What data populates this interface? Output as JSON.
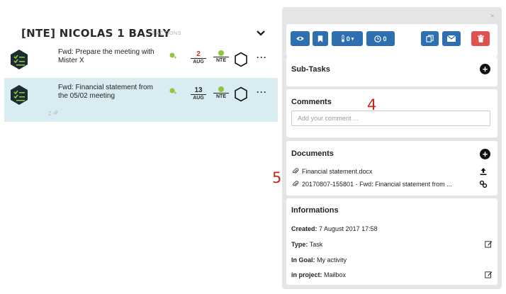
{
  "group": {
    "title": "[NTE] NICOLAS 1 BASILY",
    "count": "2 ACTIONS"
  },
  "tasks": [
    {
      "title": "Fwd: Prepare the meeting with Mister X",
      "day": "2",
      "month": "AUG",
      "assignee": "NTE"
    },
    {
      "title": "Fwd: Financial statement from the 05/02 meeting",
      "day": "13",
      "month": "AUG",
      "assignee": "NTE",
      "meta": "2"
    }
  ],
  "panel": {
    "close": "×",
    "toolbar": {
      "checklist_count": "0",
      "timer_count": "0"
    },
    "subtasks": {
      "title": "Sub-Tasks"
    },
    "comments": {
      "title": "Comments",
      "placeholder": "Add your comment ..."
    },
    "documents": {
      "title": "Documents",
      "items": [
        {
          "name": "Financial statement.docx"
        },
        {
          "name": "20170807-155801 - Fwd: Financial statement from ..."
        }
      ]
    },
    "informations": {
      "title": "Informations",
      "created_label": "Created:",
      "created_value": "7 August 2017 17:58",
      "type_label": "Type:",
      "type_value": "Task",
      "goal_label": "In Goal:",
      "goal_value": "My activity",
      "project_label": "in project:",
      "project_value": "Mailbox"
    }
  },
  "callouts": {
    "comments": "4",
    "documents": "5"
  },
  "colors": {
    "accent": "#2d6fb0",
    "danger": "#e05252",
    "selected_row": "#d9ecf2",
    "assignee": "#8fc63f",
    "overdue": "#d02b2b"
  }
}
